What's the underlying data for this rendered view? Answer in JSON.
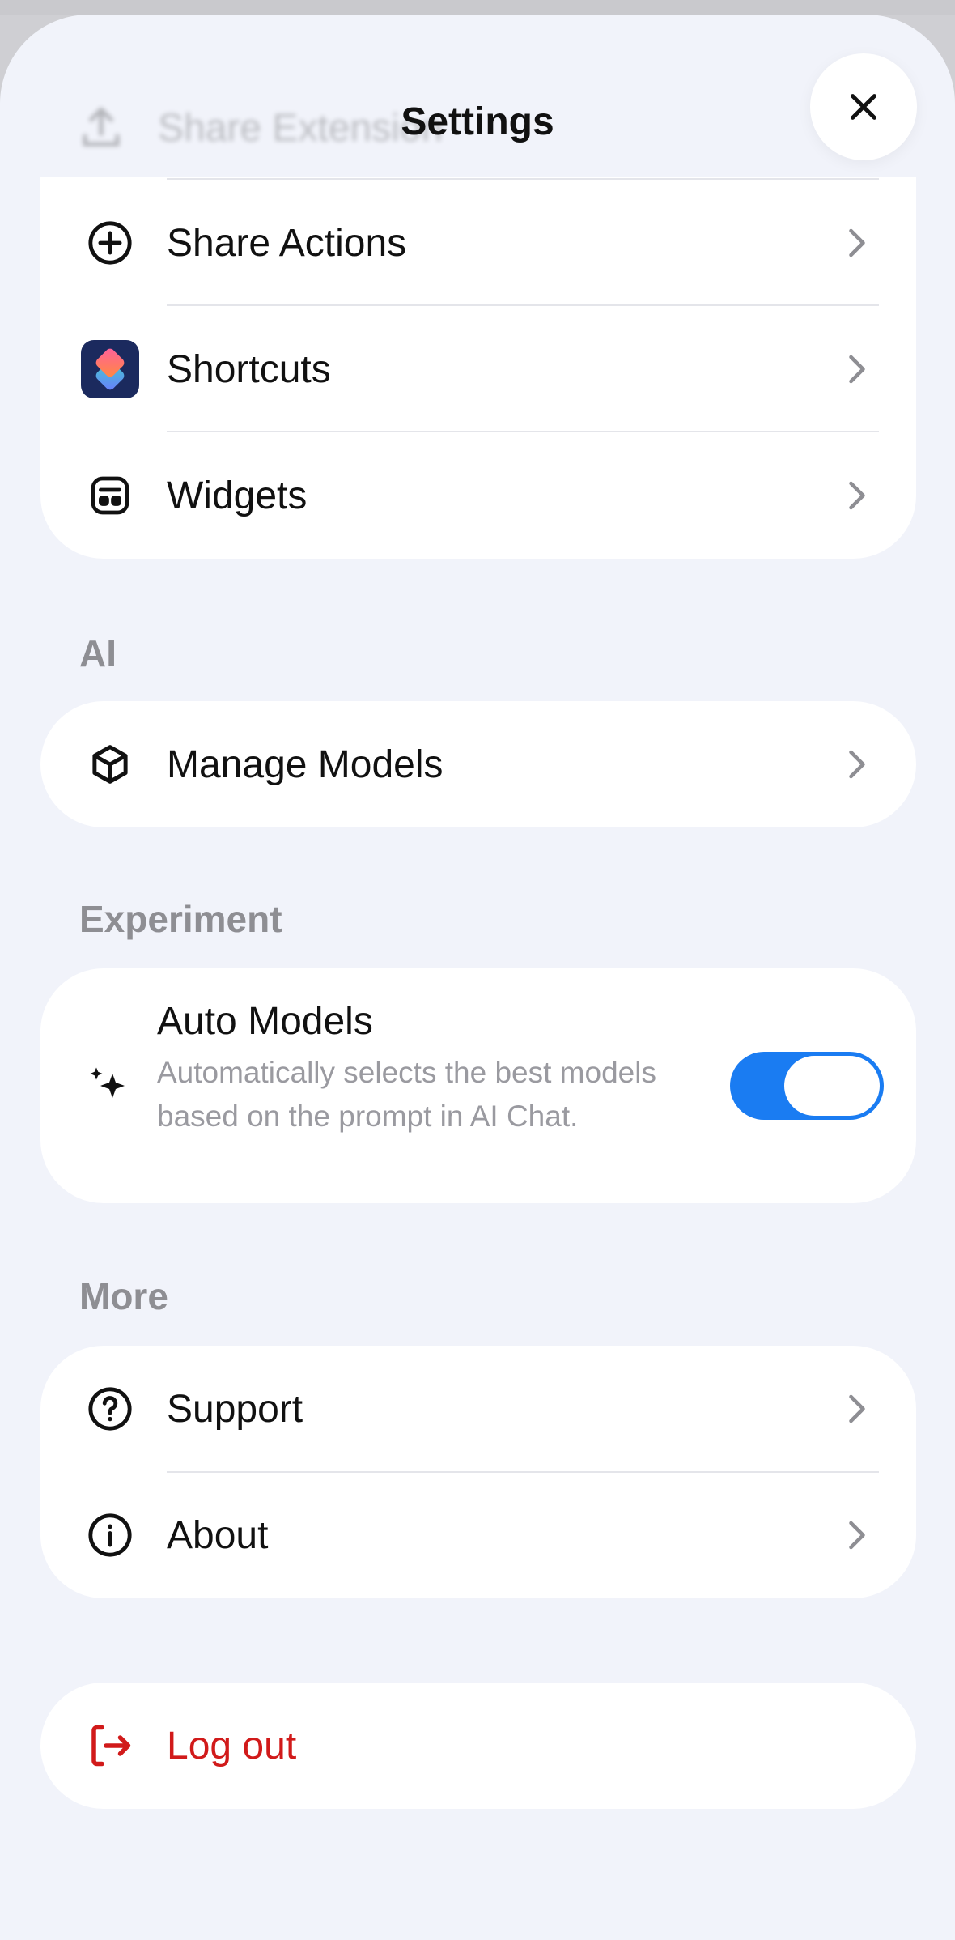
{
  "header": {
    "title": "Settings",
    "close_icon": "close-icon"
  },
  "faded_row": {
    "label": "Share Extension",
    "icon": "upload-icon"
  },
  "integrations": {
    "items": [
      {
        "label": "Share Actions",
        "icon": "plus-circle-icon"
      },
      {
        "label": "Shortcuts",
        "icon": "shortcuts-app-icon"
      },
      {
        "label": "Widgets",
        "icon": "widget-icon"
      }
    ]
  },
  "ai": {
    "section_label": "AI",
    "items": [
      {
        "label": "Manage Models",
        "icon": "cube-icon"
      }
    ]
  },
  "experiment": {
    "section_label": "Experiment",
    "auto_models": {
      "title": "Auto Models",
      "description": "Automatically selects the best models based on the prompt in AI Chat.",
      "enabled": true,
      "icon": "sparkles-icon"
    }
  },
  "more": {
    "section_label": "More",
    "items": [
      {
        "label": "Support",
        "icon": "question-circle-icon"
      },
      {
        "label": "About",
        "icon": "info-circle-icon"
      }
    ]
  },
  "logout": {
    "label": "Log out",
    "icon": "logout-icon",
    "color": "#d11a1a"
  },
  "colors": {
    "accent": "#1a7cf2",
    "background": "#f1f3fa",
    "section_label": "#8e8e93"
  }
}
